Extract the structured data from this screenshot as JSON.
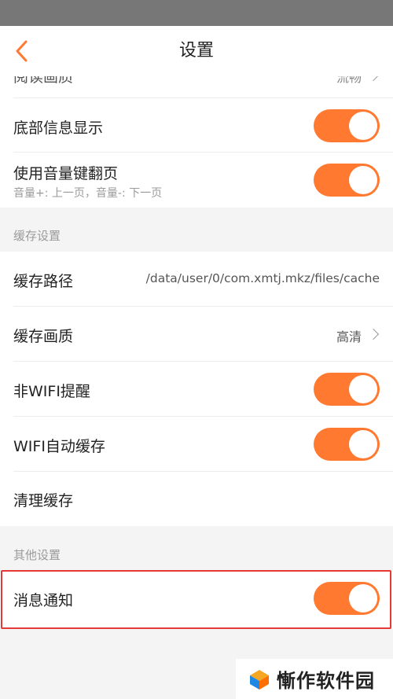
{
  "app_bar": {
    "title": "设置"
  },
  "rows": {
    "reading_quality": {
      "label": "阅读画质",
      "value": "流畅"
    },
    "bottom_info": {
      "label": "底部信息显示",
      "on": true
    },
    "volume_key": {
      "label": "使用音量键翻页",
      "sub": "音量+: 上一页，音量-: 下一页",
      "on": true
    },
    "cache_path": {
      "label": "缓存路径",
      "value": "/data/user/0/com.xmtj.mkz/files/cache"
    },
    "cache_quality": {
      "label": "缓存画质",
      "value": "高清"
    },
    "non_wifi_alert": {
      "label": "非WIFI提醒",
      "on": true
    },
    "wifi_auto_cache": {
      "label": "WIFI自动缓存",
      "on": true
    },
    "clear_cache": {
      "label": "清理缓存"
    },
    "notifications": {
      "label": "消息通知",
      "on": true
    }
  },
  "sections": {
    "cache": "缓存设置",
    "other": "其他设置"
  },
  "watermark": {
    "text": "慚作软件园"
  },
  "colors": {
    "accent": "#ff7a30",
    "highlight": "#e53935",
    "status_bar": "#777777"
  }
}
